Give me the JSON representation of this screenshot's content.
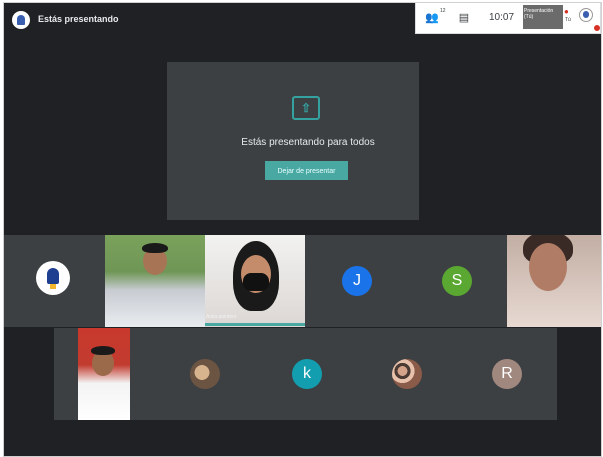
{
  "header": {
    "title": "Estás presentando"
  },
  "topbar_right": {
    "people_icon": "people-icon",
    "people_count": "12",
    "chat_icon": "chat-icon",
    "time": "10:07",
    "thumbnail_label": "Presentación (Tú)",
    "mic_off_icon": "mic-off-icon",
    "self_label": "Tú"
  },
  "presentation": {
    "icon": "present-upload-icon",
    "message": "Estás presentando para todos",
    "stop_button": "Dejar de presentar",
    "accent": "#4aa8a3"
  },
  "participants_row1": [
    {
      "type": "logo",
      "name": "school-logo"
    },
    {
      "type": "video",
      "name": "uniform-man"
    },
    {
      "type": "video",
      "name": "masked-woman",
      "label": "Aolia quintero"
    },
    {
      "type": "letter",
      "letter": "J",
      "color": "#1a73e8"
    },
    {
      "type": "letter",
      "letter": "S",
      "color": "#5aa832"
    },
    {
      "type": "video",
      "name": "woman-right"
    }
  ],
  "participants_row2": [
    {
      "type": "video",
      "name": "man-red-bg"
    },
    {
      "type": "photo",
      "name": "photo-avatar-1"
    },
    {
      "type": "letter",
      "letter": "k",
      "color": "#129eaf"
    },
    {
      "type": "photo",
      "name": "photo-avatar-2"
    },
    {
      "type": "letter",
      "letter": "R",
      "color": "#a1887f"
    }
  ]
}
